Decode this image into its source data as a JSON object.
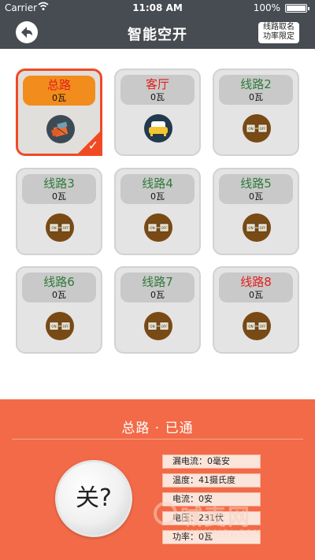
{
  "status_bar": {
    "carrier": "Carrier",
    "time": "11:08 AM",
    "battery_pct": "100%",
    "wifi_icon": "wifi-icon",
    "battery_icon": "battery-icon"
  },
  "nav": {
    "title": "智能空开",
    "rename_line1": "线路取名",
    "rename_line2": "功率限定",
    "back_icon": "back-arrow-icon"
  },
  "cards": [
    {
      "name": "总路",
      "power": "0瓦",
      "name_color": "#e0201a",
      "icon": "house-icon",
      "selected": true
    },
    {
      "name": "客厅",
      "power": "0瓦",
      "name_color": "#e0201a",
      "icon": "sofa-icon",
      "selected": false
    },
    {
      "name": "线路2",
      "power": "0瓦",
      "name_color": "#2f7a3a",
      "icon": "on-off-icon",
      "selected": false
    },
    {
      "name": "线路3",
      "power": "0瓦",
      "name_color": "#2f7a3a",
      "icon": "on-off-icon",
      "selected": false
    },
    {
      "name": "线路4",
      "power": "0瓦",
      "name_color": "#2f7a3a",
      "icon": "on-off-icon",
      "selected": false
    },
    {
      "name": "线路5",
      "power": "0瓦",
      "name_color": "#2f7a3a",
      "icon": "on-off-icon",
      "selected": false
    },
    {
      "name": "线路6",
      "power": "0瓦",
      "name_color": "#2f7a3a",
      "icon": "on-off-icon",
      "selected": false
    },
    {
      "name": "线路7",
      "power": "0瓦",
      "name_color": "#2f7a3a",
      "icon": "on-off-icon",
      "selected": false
    },
    {
      "name": "线路8",
      "power": "0瓦",
      "name_color": "#e0201a",
      "icon": "on-off-icon",
      "selected": false
    }
  ],
  "panel": {
    "state": "总路 · 已通",
    "button_label": "关?",
    "leakage": "漏电流：0毫安",
    "temperature": "温度：41摄氏度",
    "current": "电流：0安",
    "voltage": "电压：231伏",
    "power": "功率：0瓦"
  },
  "watermark": {
    "text": "喊麦网",
    "sub": "HANMAIDJ.COM"
  },
  "colors": {
    "bar_bg": "#474b52",
    "panel_bg": "#f26a47",
    "selected_border": "#f04a24",
    "selected_pill": "#f28c1c",
    "green_label": "#2f7a3a",
    "red_label": "#e0201a"
  }
}
